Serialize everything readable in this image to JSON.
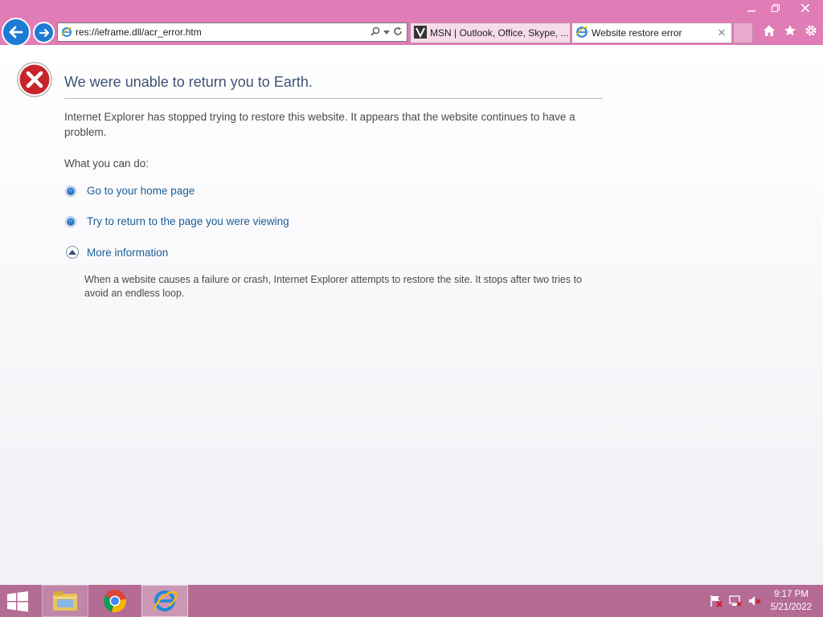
{
  "browser": {
    "address": "res://ieframe.dll/acr_error.htm",
    "tabs": [
      {
        "label": "MSN | Outlook, Office, Skype, ...",
        "active": false
      },
      {
        "label": "Website restore error",
        "active": true
      }
    ]
  },
  "page": {
    "title": "We were unable to return you to Earth.",
    "description": "Internet Explorer has stopped trying to restore this website. It appears that the website continues to have a problem.",
    "what_you_can_do": "What you can do:",
    "options": [
      "Go to your home page",
      "Try to return to the page you were viewing",
      "More information"
    ],
    "more_info_text": "When a website causes a failure or crash, Internet Explorer attempts to restore the site. It stops after two tries to avoid an endless loop."
  },
  "taskbar": {
    "time": "9:17 PM",
    "date": "5/21/2022"
  },
  "colors": {
    "titlebar": "#e07cb6",
    "taskbar": "#b46b94",
    "link": "#1a5d96",
    "heading": "#3d5277"
  }
}
